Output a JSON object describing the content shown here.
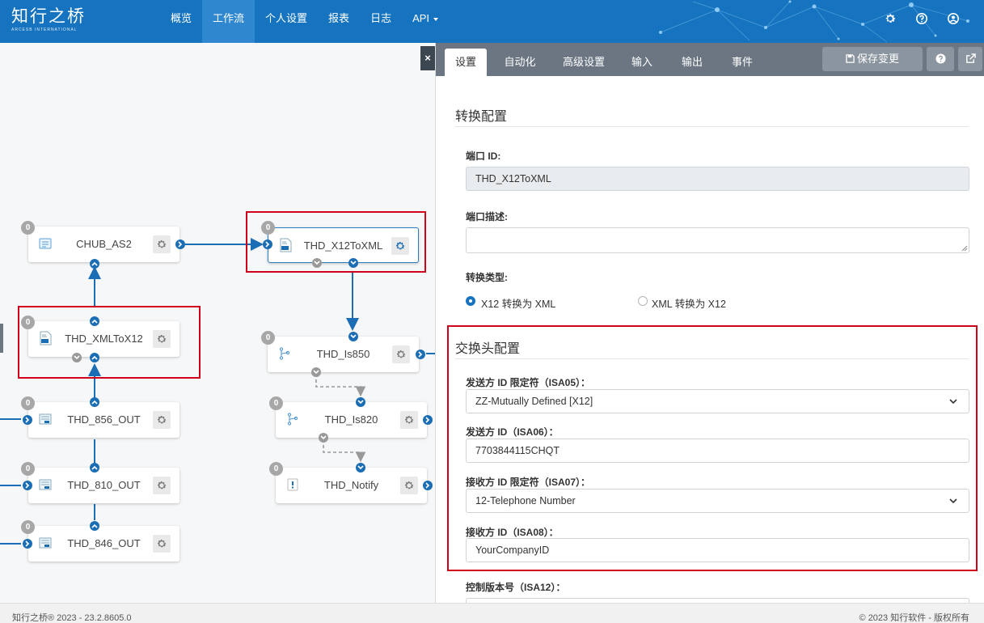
{
  "header": {
    "logo_text": "知行之桥",
    "logo_sub": "ARCESB INTERNATIONAL",
    "nav": [
      {
        "label": "概览"
      },
      {
        "label": "工作流"
      },
      {
        "label": "个人设置"
      },
      {
        "label": "报表"
      },
      {
        "label": "日志"
      },
      {
        "label": "API"
      }
    ],
    "icons": [
      "gear-icon",
      "help-icon",
      "user-icon"
    ],
    "color": "#1673bf"
  },
  "flow": {
    "nodes": [
      {
        "name": "CHUB_AS2",
        "count": "0",
        "icon": "as2-icon"
      },
      {
        "name": "THD_X12ToXML",
        "count": "0",
        "icon": "xml-icon",
        "selected": true
      },
      {
        "name": "THD_XMLToX12",
        "count": "0",
        "icon": "edi-icon"
      },
      {
        "name": "THD_Is850",
        "count": "0",
        "icon": "branch-icon"
      },
      {
        "name": "THD_856_OUT",
        "count": "0",
        "icon": "edi-icon"
      },
      {
        "name": "THD_Is820",
        "count": "0",
        "icon": "branch-icon"
      },
      {
        "name": "THD_810_OUT",
        "count": "0",
        "icon": "edi-icon"
      },
      {
        "name": "THD_Notify",
        "count": "0",
        "icon": "notify-icon"
      },
      {
        "name": "THD_846_OUT",
        "count": "0",
        "icon": "edi-icon"
      }
    ],
    "highlight_color": "#d0021b"
  },
  "panel": {
    "tabs": [
      "设置",
      "自动化",
      "高级设置",
      "输入",
      "输出",
      "事件"
    ],
    "active_tab": "设置",
    "save_label": "保存变更",
    "conversion": {
      "title": "转换配置",
      "port_id_label": "端口 ID:",
      "port_id_value": "THD_X12ToXML",
      "desc_label": "端口描述:",
      "desc_value": "",
      "type_label": "转换类型:",
      "type_options": [
        "X12 转换为 XML",
        "XML 转换为 X12"
      ],
      "type_selected": "X12 转换为 XML"
    },
    "interchange": {
      "title": "交换头配置",
      "isa05_label": "发送方 ID 限定符（ISA05）：",
      "isa05_value": "ZZ-Mutually Defined [X12]",
      "isa06_label": "发送方 ID（ISA06）：",
      "isa06_value": "7703844115CHQT",
      "isa07_label": "接收方 ID 限定符（ISA07）：",
      "isa07_value": "12-Telephone Number",
      "isa08_label": "接收方 ID（ISA08）：",
      "isa08_value": "YourCompanyID",
      "isa12_label": "控制版本号（ISA12）："
    }
  },
  "footer": {
    "left": "知行之桥® 2023 - 23.2.8605.0",
    "right": "© 2023 知行软件 - 版权所有"
  }
}
